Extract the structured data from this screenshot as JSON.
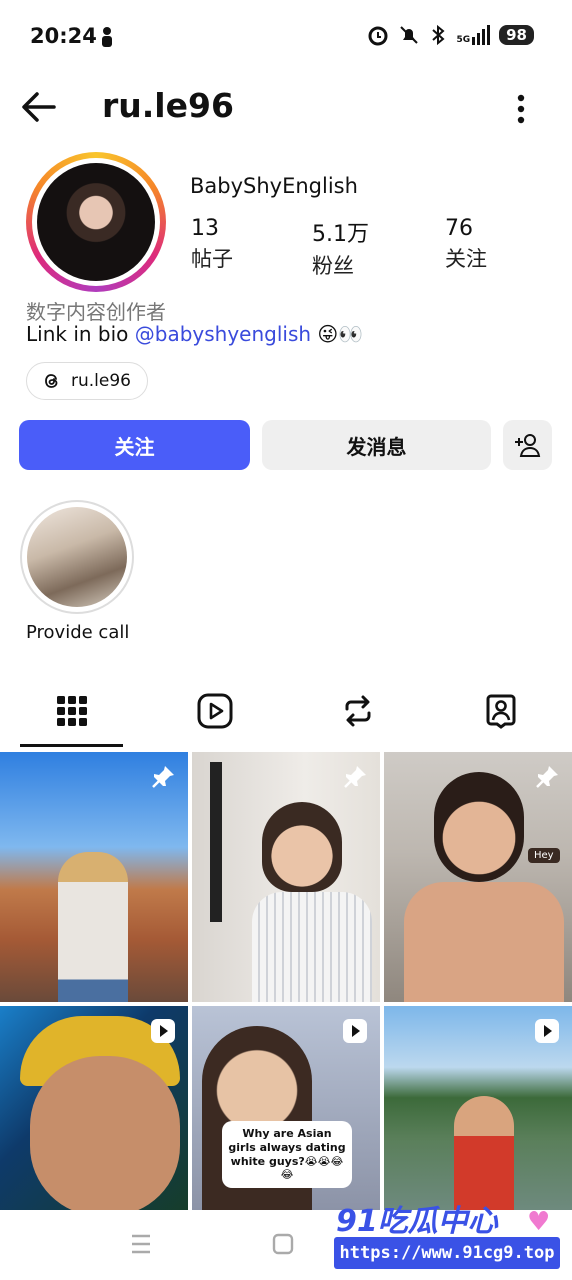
{
  "status_bar": {
    "time": "20:24",
    "network": "5G",
    "battery": "98"
  },
  "header": {
    "username": "ru.le96"
  },
  "profile": {
    "display_name": "BabyShyEnglish",
    "stats": [
      {
        "value": "13",
        "label": "帖子"
      },
      {
        "value": "5.1万",
        "label": "粉丝"
      },
      {
        "value": "76",
        "label": "关注"
      }
    ],
    "category": "数字内容创作者",
    "bio_prefix": "Link in bio ",
    "bio_mention": "@babyshyenglish",
    "bio_emoji": "😜👀",
    "threads_handle": "ru.le96"
  },
  "actions": {
    "follow": "关注",
    "message": "发消息"
  },
  "highlights": [
    {
      "label": "Provide call"
    }
  ],
  "grid": {
    "posts": [
      {
        "badge": "pin-icon"
      },
      {
        "badge": "pin-icon"
      },
      {
        "badge": "pin-icon",
        "overlay": "Hey"
      },
      {
        "badge": "reel-icon"
      },
      {
        "badge": "reel-icon",
        "caption": "Why are Asian girls always dating white guys?😭😭😂😂"
      },
      {
        "badge": "reel-icon"
      }
    ]
  },
  "watermark": {
    "logo": "91吃瓜中心",
    "url": "https://www.91cg9.top"
  },
  "colors": {
    "accent": "#4a5df9",
    "mention": "#3a4bdc"
  }
}
